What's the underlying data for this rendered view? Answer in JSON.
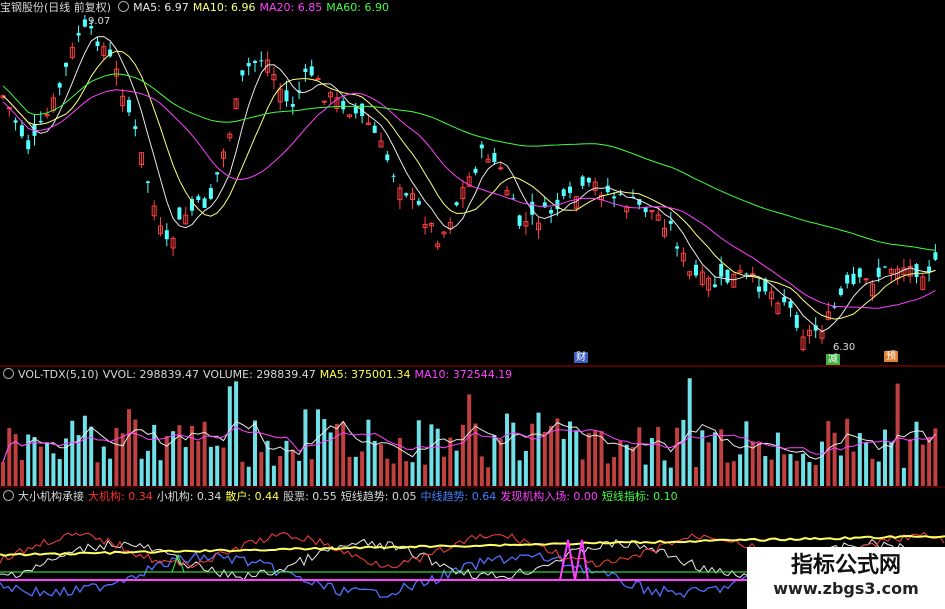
{
  "main_header": {
    "title": "宝钢股份(日线 前复权)",
    "ma5": "MA5: 6.97",
    "ma10": "MA10: 6.96",
    "ma20": "MA20: 6.85",
    "ma60": "MA60: 6.90"
  },
  "price_labels": {
    "high": "9.07",
    "low": "6.30"
  },
  "event_markers": {
    "m1": "",
    "m2": "财",
    "m3": "减",
    "m4": "预"
  },
  "vol_header": {
    "name": "VOL-TDX(5,10)",
    "vvol": "VVOL: 298839.47",
    "volume": "VOLUME: 298839.47",
    "ma5": "MA5: 375001.34",
    "ma10": "MA10: 372544.19"
  },
  "ind_header": {
    "name": "大小机构承接",
    "big": "大机构: 0.34",
    "small": "小机构: 0.34",
    "retail": "散户: 0.44",
    "stock": "股票: 0.55",
    "trend": "短线趋势: 0.05",
    "mid": "中线趋势: 0.64",
    "entry": "发现机构入场: 0.00",
    "short": "短线指标: 0.10"
  },
  "watermark": {
    "line1": "指标公式网",
    "line2": "www.zbgs3.com"
  },
  "colors": {
    "up": "#ff4040",
    "down": "#54ffff",
    "ma5": "#e8e8e8",
    "ma10": "#ffff80",
    "ma20": "#ff40ff",
    "ma60": "#40ff40",
    "divider": "#b00000"
  }
}
